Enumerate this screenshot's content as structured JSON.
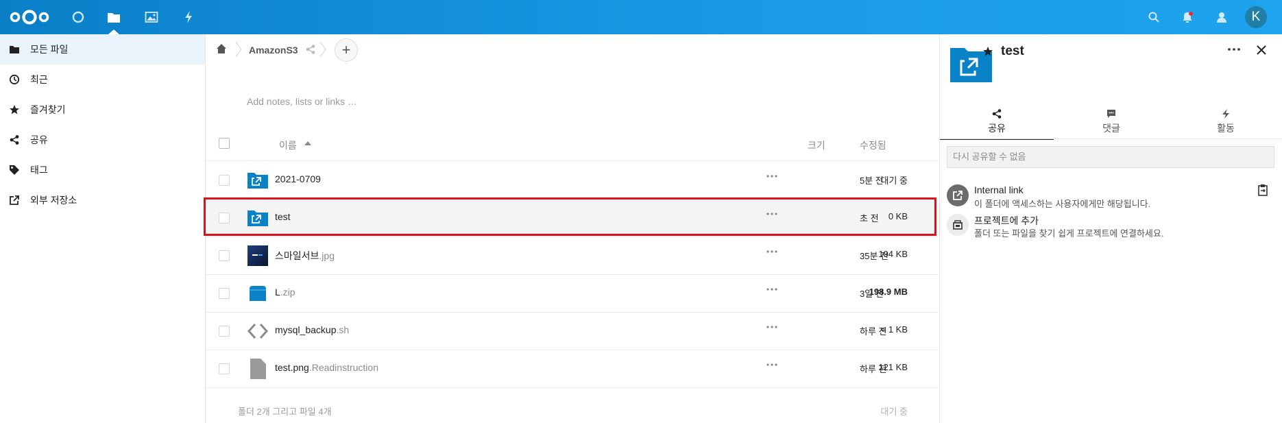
{
  "header": {
    "apps": [
      {
        "name": "dashboard",
        "icon": "circle-icon"
      },
      {
        "name": "files",
        "icon": "folder-icon",
        "active": true
      },
      {
        "name": "photos",
        "icon": "image-icon"
      },
      {
        "name": "activity",
        "icon": "lightning-icon"
      }
    ],
    "avatar_letter": "K"
  },
  "sidebar": {
    "items": [
      {
        "label": "모든 파일",
        "icon": "folder-icon",
        "active": true
      },
      {
        "label": "최근",
        "icon": "clock-icon"
      },
      {
        "label": "즐겨찾기",
        "icon": "star-icon"
      },
      {
        "label": "공유",
        "icon": "share-icon"
      },
      {
        "label": "태그",
        "icon": "tag-icon"
      },
      {
        "label": "외부 저장소",
        "icon": "external-link-icon"
      }
    ]
  },
  "breadcrumb": {
    "folder": "AmazonS3",
    "add": "+"
  },
  "notes_placeholder": "Add notes, lists or links …",
  "table": {
    "headers": {
      "name": "이름",
      "size": "크기",
      "modified": "수정됨"
    },
    "rows": [
      {
        "name": "2021-0709",
        "ext": "",
        "type": "shared-folder",
        "size": "대기 중",
        "modified": "5분 전",
        "bold_size": false
      },
      {
        "name": "test",
        "ext": "",
        "type": "shared-folder",
        "size": "0 KB",
        "modified": "초 전",
        "selected": true
      },
      {
        "name": "스마일서브",
        "ext": ".jpg",
        "type": "image",
        "size": "194 KB",
        "modified": "35분 전"
      },
      {
        "name": "L",
        "ext": ".zip",
        "type": "archive",
        "size": "198.9 MB",
        "modified": "3일 전"
      },
      {
        "name": "mysql_backup",
        "ext": ".sh",
        "type": "code",
        "size": "< 1 KB",
        "modified": "하루 전"
      },
      {
        "name": "test.png",
        "ext": ".Readinstruction",
        "type": "file",
        "size": "121 KB",
        "modified": "하루 전"
      }
    ],
    "summary": "폴더 2개 그리고 파일 4개",
    "summary_size": "대기 중"
  },
  "panel": {
    "title": "test",
    "tabs": [
      {
        "label": "공유",
        "icon": "share-icon",
        "active": true
      },
      {
        "label": "댓글",
        "icon": "comment-icon"
      },
      {
        "label": "활동",
        "icon": "lightning-icon"
      }
    ],
    "reshare_notice": "다시 공유할 수 없음",
    "internal_link": {
      "title": "Internal link",
      "subtitle": "이 폴더에 액세스하는 사용자에게만 해당됩니다."
    },
    "project": {
      "title": "프로젝트에 추가",
      "subtitle": "폴더 또는 파일을 찾기 쉽게 프로젝트에 연결하세요."
    }
  },
  "colors": {
    "header": "#0a7fc8",
    "accent": "#0082c9",
    "highlight": "#d9131e"
  }
}
